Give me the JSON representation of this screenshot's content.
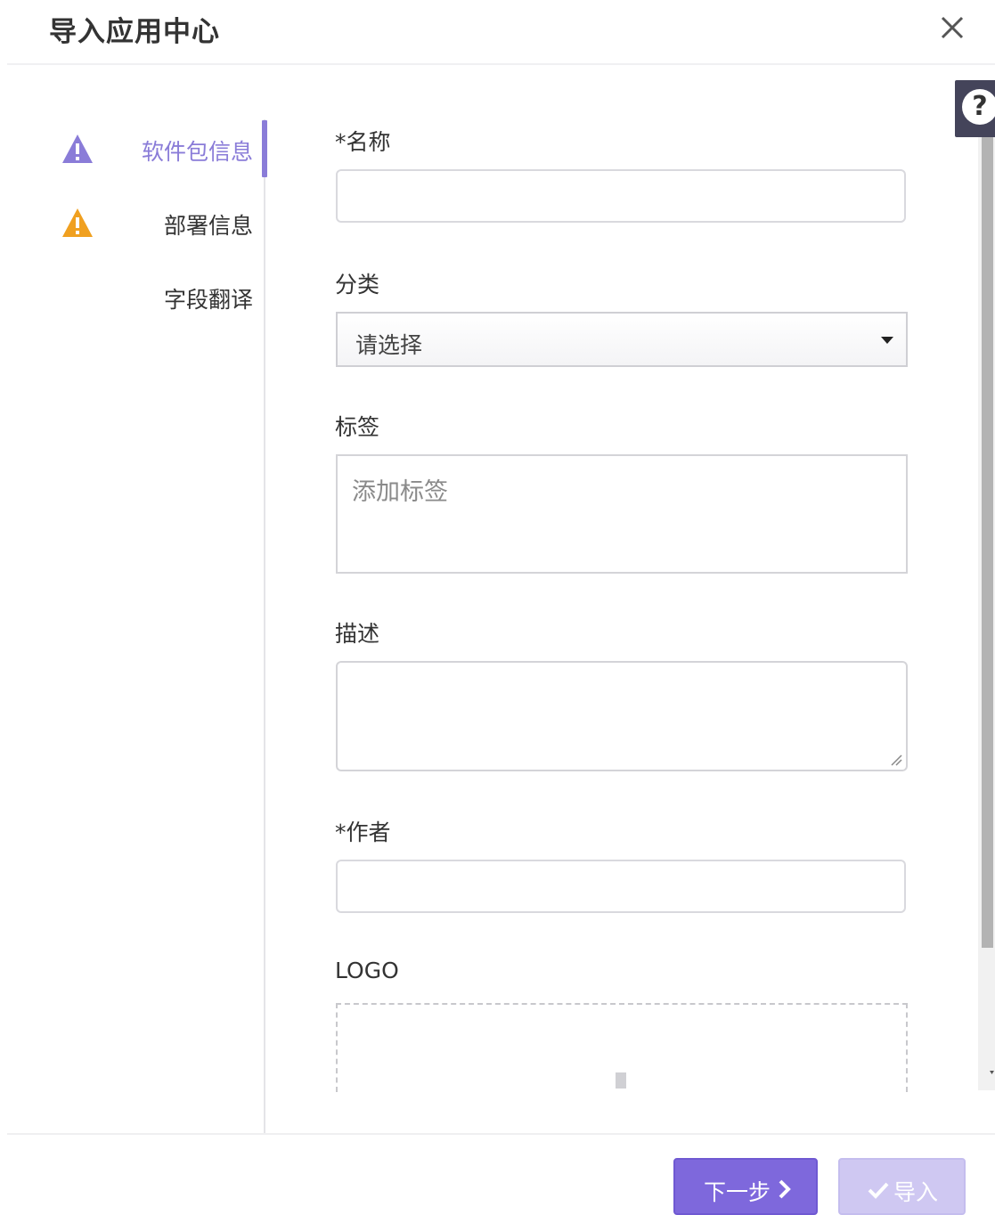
{
  "dialog": {
    "title": "导入应用中心",
    "close_icon": "close-icon",
    "help_icon": "question-circle-icon"
  },
  "steps": [
    {
      "label": "软件包信息",
      "status_icon": "warning-triangle-icon",
      "active": true,
      "icon_color": "#8a7cd8"
    },
    {
      "label": "部署信息",
      "status_icon": "warning-triangle-icon",
      "active": false,
      "icon_color": "#f0a020"
    },
    {
      "label": "字段翻译",
      "status_icon": "",
      "active": false
    }
  ],
  "form": {
    "name": {
      "label": "*名称",
      "value": ""
    },
    "category": {
      "label": "分类",
      "selected": "请选择"
    },
    "tags": {
      "label": "标签",
      "placeholder": "添加标签"
    },
    "description": {
      "label": "描述",
      "value": ""
    },
    "author": {
      "label": "*作者",
      "value": ""
    },
    "logo": {
      "label": "LOGO"
    }
  },
  "footer": {
    "next_label": "下一步",
    "next_icon": "chevron-right-icon",
    "import_label": "导入",
    "import_icon": "check-icon"
  },
  "colors": {
    "accent": "#7e68dc",
    "accent_disabled": "#cfc8f2",
    "warning": "#f0a020"
  }
}
